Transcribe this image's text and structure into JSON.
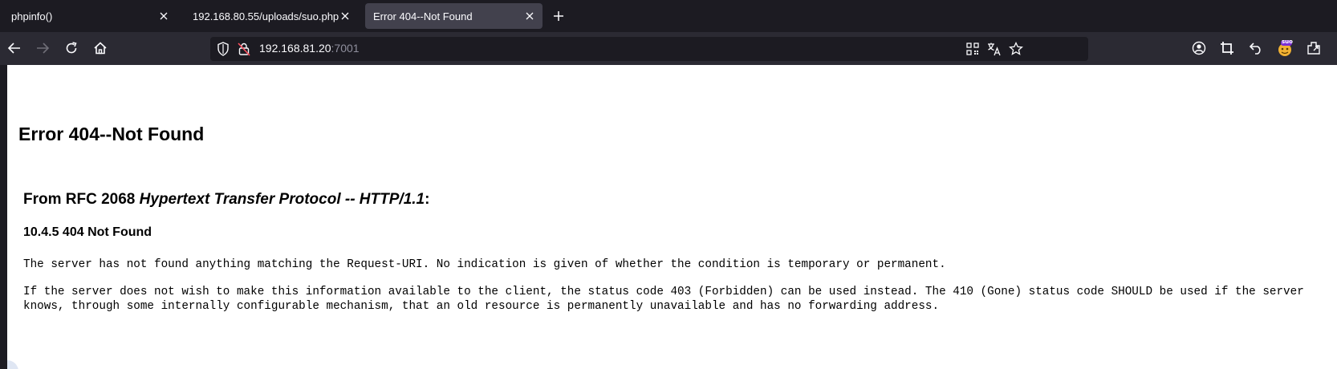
{
  "tabs": [
    {
      "label": "phpinfo()",
      "active": false
    },
    {
      "label": "192.168.80.55/uploads/suo.php",
      "active": false
    },
    {
      "label": "Error 404--Not Found",
      "active": true
    }
  ],
  "navbar": {
    "url_host": "192.168.81.20",
    "url_port": ":7001",
    "extension_badge": "suo"
  },
  "page": {
    "title": "Error 404--Not Found",
    "rfc_prefix": "From RFC 2068 ",
    "rfc_title": "Hypertext Transfer Protocol -- HTTP/1.1",
    "rfc_suffix": ":",
    "section": "10.4.5 404 Not Found",
    "paragraph1": "The server has not found anything matching the Request-URI. No indication is given of whether the condition is temporary or permanent.",
    "paragraph2_line1": "If the server does not wish to make this information available to the client, the status code 403 (Forbidden) can be used instead. The 410 (Gone) status code SHOULD be used if the server",
    "paragraph2_line2": "knows, through some internally configurable mechanism, that an old resource is permanently unavailable and has no forwarding address."
  },
  "colors": {
    "tabbar_bg": "#1c1b22",
    "navbar_bg": "#2b2a33",
    "active_tab_bg": "#42414d",
    "page_bg": "#ffffff"
  }
}
